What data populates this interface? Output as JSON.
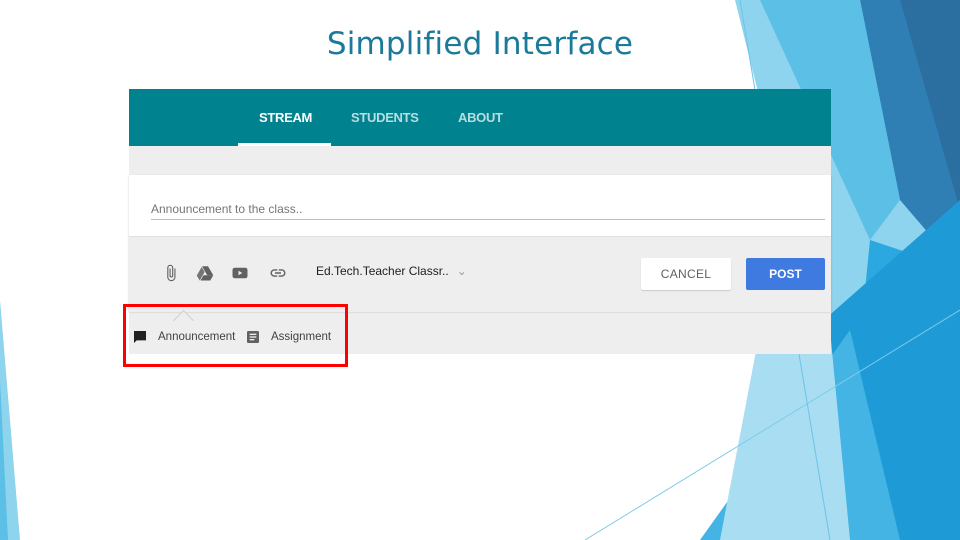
{
  "slide": {
    "title": "Simplified Interface"
  },
  "classroom": {
    "tabs": [
      {
        "label": "STREAM",
        "active": true
      },
      {
        "label": "STUDENTS",
        "active": false
      },
      {
        "label": "ABOUT",
        "active": false
      }
    ],
    "compose": {
      "placeholder": "Announcement to the class..",
      "toolbar_icons": [
        "attach-icon",
        "drive-icon",
        "youtube-icon",
        "link-icon"
      ],
      "class_select": "Ed.Tech.Teacher Classr..",
      "cancel_label": "CANCEL",
      "post_label": "POST"
    },
    "post_types": [
      {
        "label": "Announcement",
        "icon": "announcement-icon"
      },
      {
        "label": "Assignment",
        "icon": "assignment-icon"
      }
    ]
  },
  "colors": {
    "header": "#00838f",
    "post_button": "#3f7ae0",
    "highlight": "#ff0000",
    "title": "#1b7a9a"
  }
}
